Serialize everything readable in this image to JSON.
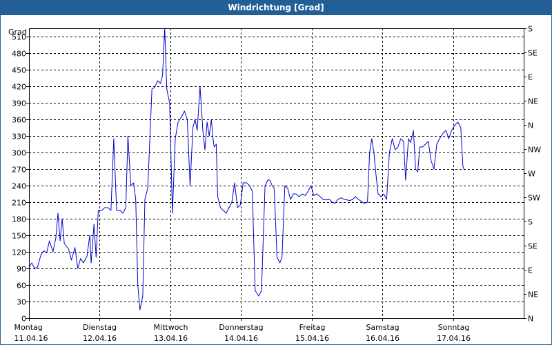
{
  "chart_data": {
    "type": "line",
    "title": "Windrichtung [Grad]",
    "ylabel": "Grad",
    "ylim": [
      0,
      525
    ],
    "y_ticks": [
      0,
      30,
      60,
      90,
      120,
      150,
      180,
      210,
      240,
      270,
      300,
      330,
      360,
      390,
      420,
      450,
      480,
      510
    ],
    "y_right_ticks": [
      {
        "value": 0,
        "label": "N"
      },
      {
        "value": 45,
        "label": "NE"
      },
      {
        "value": 90,
        "label": "E"
      },
      {
        "value": 135,
        "label": "SE"
      },
      {
        "value": 180,
        "label": "S"
      },
      {
        "value": 225,
        "label": "SW"
      },
      {
        "value": 270,
        "label": "W"
      },
      {
        "value": 315,
        "label": "NW"
      },
      {
        "value": 360,
        "label": "N"
      },
      {
        "value": 405,
        "label": "NE"
      },
      {
        "value": 450,
        "label": "E"
      },
      {
        "value": 495,
        "label": "SE"
      },
      {
        "value": 540,
        "label": "S"
      }
    ],
    "xlim": [
      0,
      7
    ],
    "x_ticks": [
      {
        "day": "Montag",
        "date": "11.04.16"
      },
      {
        "day": "Dienstag",
        "date": "12.04.16"
      },
      {
        "day": "Mittwoch",
        "date": "13.04.16"
      },
      {
        "day": "Donnerstag",
        "date": "14.04.16"
      },
      {
        "day": "Freitag",
        "date": "15.04.16"
      },
      {
        "day": "Samstag",
        "date": "16.04.16"
      },
      {
        "day": "Sonntag",
        "date": "17.04.16"
      }
    ],
    "grid": true,
    "series": [
      {
        "color": "#0000cc",
        "points": [
          [
            0.0,
            92
          ],
          [
            0.04,
            100
          ],
          [
            0.08,
            90
          ],
          [
            0.12,
            92
          ],
          [
            0.17,
            115
          ],
          [
            0.21,
            122
          ],
          [
            0.25,
            118
          ],
          [
            0.29,
            140
          ],
          [
            0.34,
            120
          ],
          [
            0.38,
            145
          ],
          [
            0.41,
            190
          ],
          [
            0.44,
            140
          ],
          [
            0.47,
            180
          ],
          [
            0.5,
            135
          ],
          [
            0.56,
            125
          ],
          [
            0.6,
            105
          ],
          [
            0.65,
            128
          ],
          [
            0.69,
            90
          ],
          [
            0.73,
            108
          ],
          [
            0.77,
            100
          ],
          [
            0.82,
            112
          ],
          [
            0.86,
            150
          ],
          [
            0.88,
            100
          ],
          [
            0.92,
            170
          ],
          [
            0.95,
            110
          ],
          [
            0.98,
            195
          ],
          [
            1.03,
            195
          ],
          [
            1.07,
            200
          ],
          [
            1.12,
            200
          ],
          [
            1.16,
            195
          ],
          [
            1.2,
            325
          ],
          [
            1.24,
            195
          ],
          [
            1.29,
            195
          ],
          [
            1.33,
            190
          ],
          [
            1.37,
            200
          ],
          [
            1.4,
            330
          ],
          [
            1.44,
            240
          ],
          [
            1.48,
            245
          ],
          [
            1.51,
            215
          ],
          [
            1.54,
            60
          ],
          [
            1.57,
            15
          ],
          [
            1.61,
            40
          ],
          [
            1.64,
            215
          ],
          [
            1.68,
            235
          ],
          [
            1.71,
            325
          ],
          [
            1.74,
            415
          ],
          [
            1.78,
            418
          ],
          [
            1.82,
            430
          ],
          [
            1.86,
            425
          ],
          [
            1.89,
            440
          ],
          [
            1.92,
            525
          ],
          [
            1.95,
            415
          ],
          [
            1.99,
            390
          ],
          [
            2.03,
            190
          ],
          [
            2.07,
            325
          ],
          [
            2.11,
            355
          ],
          [
            2.16,
            365
          ],
          [
            2.2,
            375
          ],
          [
            2.24,
            360
          ],
          [
            2.28,
            240
          ],
          [
            2.32,
            345
          ],
          [
            2.35,
            360
          ],
          [
            2.38,
            340
          ],
          [
            2.42,
            420
          ],
          [
            2.46,
            340
          ],
          [
            2.49,
            305
          ],
          [
            2.52,
            355
          ],
          [
            2.55,
            330
          ],
          [
            2.58,
            360
          ],
          [
            2.6,
            330
          ],
          [
            2.62,
            310
          ],
          [
            2.65,
            315
          ],
          [
            2.67,
            220
          ],
          [
            2.71,
            200
          ],
          [
            2.75,
            195
          ],
          [
            2.79,
            190
          ],
          [
            2.83,
            200
          ],
          [
            2.87,
            210
          ],
          [
            2.91,
            245
          ],
          [
            2.95,
            200
          ],
          [
            2.99,
            205
          ],
          [
            3.03,
            245
          ],
          [
            3.08,
            245
          ],
          [
            3.12,
            240
          ],
          [
            3.16,
            230
          ],
          [
            3.2,
            50
          ],
          [
            3.25,
            40
          ],
          [
            3.29,
            50
          ],
          [
            3.34,
            240
          ],
          [
            3.38,
            250
          ],
          [
            3.41,
            250
          ],
          [
            3.44,
            240
          ],
          [
            3.47,
            235
          ],
          [
            3.51,
            110
          ],
          [
            3.55,
            100
          ],
          [
            3.58,
            110
          ],
          [
            3.62,
            240
          ],
          [
            3.66,
            235
          ],
          [
            3.7,
            215
          ],
          [
            3.74,
            225
          ],
          [
            3.78,
            225
          ],
          [
            3.82,
            220
          ],
          [
            3.87,
            225
          ],
          [
            3.91,
            222
          ],
          [
            3.95,
            230
          ],
          [
            3.99,
            240
          ],
          [
            4.03,
            222
          ],
          [
            4.07,
            225
          ],
          [
            4.12,
            220
          ],
          [
            4.16,
            215
          ],
          [
            4.2,
            214
          ],
          [
            4.25,
            215
          ],
          [
            4.29,
            210
          ],
          [
            4.33,
            208
          ],
          [
            4.37,
            215
          ],
          [
            4.42,
            218
          ],
          [
            4.46,
            215
          ],
          [
            4.5,
            214
          ],
          [
            4.54,
            213
          ],
          [
            4.58,
            215
          ],
          [
            4.62,
            220
          ],
          [
            4.66,
            215
          ],
          [
            4.7,
            212
          ],
          [
            4.74,
            208
          ],
          [
            4.79,
            210
          ],
          [
            4.82,
            300
          ],
          [
            4.85,
            325
          ],
          [
            4.88,
            300
          ],
          [
            4.91,
            260
          ],
          [
            4.94,
            225
          ],
          [
            4.98,
            220
          ],
          [
            5.02,
            225
          ],
          [
            5.06,
            215
          ],
          [
            5.1,
            300
          ],
          [
            5.14,
            325
          ],
          [
            5.18,
            305
          ],
          [
            5.22,
            310
          ],
          [
            5.26,
            325
          ],
          [
            5.3,
            320
          ],
          [
            5.33,
            250
          ],
          [
            5.37,
            325
          ],
          [
            5.4,
            318
          ],
          [
            5.44,
            340
          ],
          [
            5.47,
            270
          ],
          [
            5.5,
            265
          ],
          [
            5.53,
            310
          ],
          [
            5.57,
            310
          ],
          [
            5.61,
            315
          ],
          [
            5.65,
            320
          ],
          [
            5.69,
            285
          ],
          [
            5.73,
            270
          ],
          [
            5.77,
            315
          ],
          [
            5.81,
            325
          ],
          [
            5.86,
            335
          ],
          [
            5.9,
            340
          ],
          [
            5.94,
            325
          ],
          [
            5.98,
            340
          ],
          [
            6.03,
            350
          ],
          [
            6.07,
            355
          ],
          [
            6.11,
            345
          ],
          [
            6.14,
            275
          ],
          [
            6.16,
            268
          ]
        ]
      }
    ]
  }
}
